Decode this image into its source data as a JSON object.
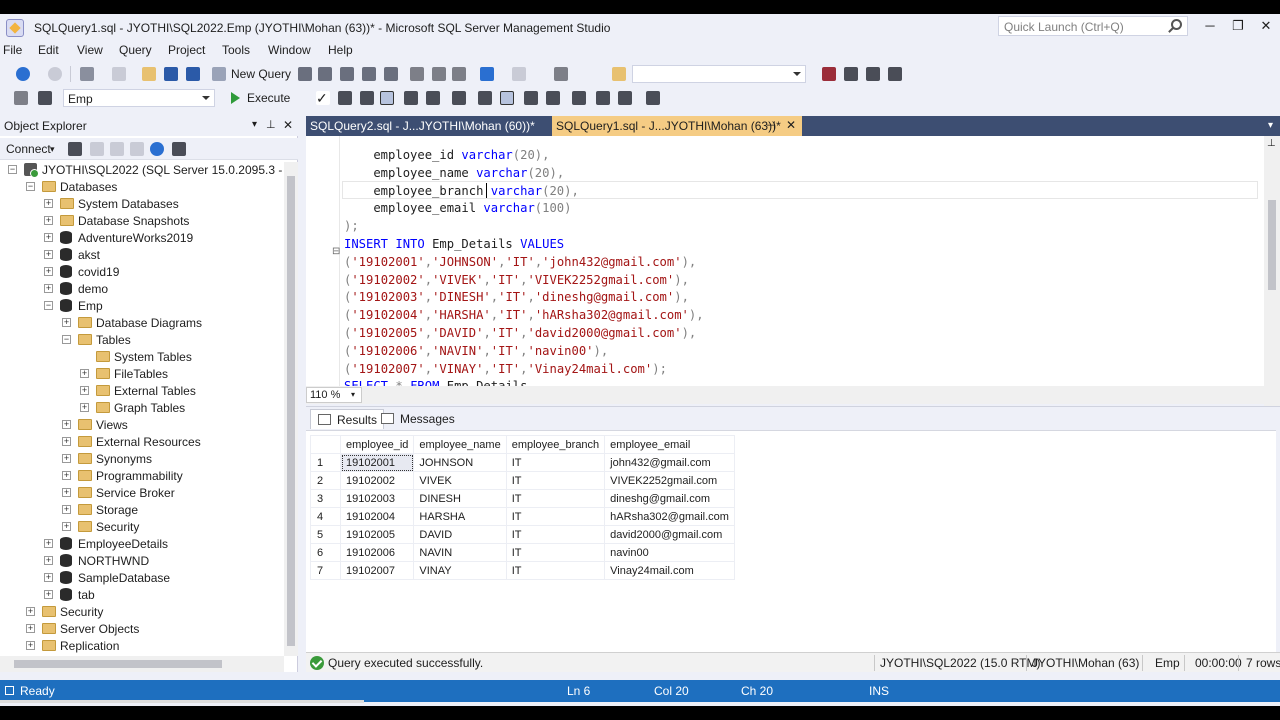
{
  "window": {
    "title": "SQLQuery1.sql - JYOTHI\\SQL2022.Emp (JYOTHI\\Mohan (63))* - Microsoft SQL Server Management Studio",
    "quick_launch_placeholder": "Quick Launch (Ctrl+Q)",
    "controls": {
      "min": "─",
      "restore": "❐",
      "close": "✕"
    }
  },
  "menu": [
    "File",
    "Edit",
    "View",
    "Query",
    "Project",
    "Tools",
    "Window",
    "Help"
  ],
  "toolbar": {
    "new_query_label": "New Query",
    "database_selected": "Emp",
    "execute_label": "Execute"
  },
  "object_explorer": {
    "title": "Object Explorer",
    "connect_label": "Connect",
    "tree": [
      {
        "label": "JYOTHI\\SQL2022 (SQL Server 15.0.2095.3 - JYOTHI\\Mohan)",
        "icon": "server-icon",
        "level": 0,
        "expander": "−"
      },
      {
        "label": "Databases",
        "icon": "folder-icon",
        "level": 1,
        "expander": "−"
      },
      {
        "label": "System Databases",
        "icon": "folder-icon",
        "level": 2,
        "expander": "+"
      },
      {
        "label": "Database Snapshots",
        "icon": "folder-icon",
        "level": 2,
        "expander": "+"
      },
      {
        "label": "AdventureWorks2019",
        "icon": "database-icon",
        "level": 2,
        "expander": "+"
      },
      {
        "label": "akst",
        "icon": "database-icon",
        "level": 2,
        "expander": "+"
      },
      {
        "label": "covid19",
        "icon": "database-icon",
        "level": 2,
        "expander": "+"
      },
      {
        "label": "demo",
        "icon": "database-icon",
        "level": 2,
        "expander": "+"
      },
      {
        "label": "Emp",
        "icon": "database-icon",
        "level": 2,
        "expander": "−"
      },
      {
        "label": "Database Diagrams",
        "icon": "folder-icon",
        "level": 3,
        "expander": "+"
      },
      {
        "label": "Tables",
        "icon": "folder-icon",
        "level": 3,
        "expander": "−"
      },
      {
        "label": "System Tables",
        "icon": "folder-icon",
        "level": 4,
        "expander": ""
      },
      {
        "label": "FileTables",
        "icon": "folder-icon",
        "level": 4,
        "expander": "+"
      },
      {
        "label": "External Tables",
        "icon": "folder-icon",
        "level": 4,
        "expander": "+"
      },
      {
        "label": "Graph Tables",
        "icon": "folder-icon",
        "level": 4,
        "expander": "+"
      },
      {
        "label": "Views",
        "icon": "folder-icon",
        "level": 3,
        "expander": "+"
      },
      {
        "label": "External Resources",
        "icon": "folder-icon",
        "level": 3,
        "expander": "+"
      },
      {
        "label": "Synonyms",
        "icon": "folder-icon",
        "level": 3,
        "expander": "+"
      },
      {
        "label": "Programmability",
        "icon": "folder-icon",
        "level": 3,
        "expander": "+"
      },
      {
        "label": "Service Broker",
        "icon": "folder-icon",
        "level": 3,
        "expander": "+"
      },
      {
        "label": "Storage",
        "icon": "folder-icon",
        "level": 3,
        "expander": "+"
      },
      {
        "label": "Security",
        "icon": "folder-icon",
        "level": 3,
        "expander": "+"
      },
      {
        "label": "EmployeeDetails",
        "icon": "database-icon",
        "level": 2,
        "expander": "+"
      },
      {
        "label": "NORTHWND",
        "icon": "database-icon",
        "level": 2,
        "expander": "+"
      },
      {
        "label": "SampleDatabase",
        "icon": "database-icon",
        "level": 2,
        "expander": "+"
      },
      {
        "label": "tab",
        "icon": "database-icon",
        "level": 2,
        "expander": "+"
      },
      {
        "label": "Security",
        "icon": "folder-icon",
        "level": 1,
        "expander": "+"
      },
      {
        "label": "Server Objects",
        "icon": "folder-icon",
        "level": 1,
        "expander": "+"
      },
      {
        "label": "Replication",
        "icon": "folder-icon",
        "level": 1,
        "expander": "+"
      }
    ]
  },
  "tabs": [
    {
      "label": "SQLQuery2.sql - J...JYOTHI\\Mohan (60))*",
      "active": false
    },
    {
      "label": "SQLQuery1.sql - J...JYOTHI\\Mohan (63))*",
      "active": true
    }
  ],
  "editor": {
    "zoom": "110 %",
    "lines": [
      [
        [
          "    employee_id ",
          "tx"
        ],
        [
          "varchar",
          "kw"
        ],
        [
          "(20)",
          "gr"
        ],
        [
          ",",
          "gr"
        ]
      ],
      [
        [
          "    employee_name ",
          "tx"
        ],
        [
          "varchar",
          "kw"
        ],
        [
          "(20)",
          "gr"
        ],
        [
          ",",
          "gr"
        ]
      ],
      [
        [
          "    employee_branch ",
          "tx"
        ],
        [
          "varchar",
          "kw"
        ],
        [
          "(20)",
          "gr"
        ],
        [
          ",",
          "gr"
        ]
      ],
      [
        [
          "    employee_email ",
          "tx"
        ],
        [
          "varchar",
          "kw"
        ],
        [
          "(100)",
          "gr"
        ]
      ],
      [
        [
          ");",
          "gr"
        ]
      ],
      [
        [
          "INSERT INTO ",
          "kw"
        ],
        [
          "Emp_Details ",
          "tx"
        ],
        [
          "VALUES",
          "kw"
        ]
      ],
      [
        [
          "(",
          "gr"
        ],
        [
          "'19102001'",
          "st"
        ],
        [
          ",",
          "gr"
        ],
        [
          "'JOHNSON'",
          "st"
        ],
        [
          ",",
          "gr"
        ],
        [
          "'IT'",
          "st"
        ],
        [
          ",",
          "gr"
        ],
        [
          "'john432@gmail.com'",
          "st"
        ],
        [
          "),",
          "gr"
        ]
      ],
      [
        [
          "(",
          "gr"
        ],
        [
          "'19102002'",
          "st"
        ],
        [
          ",",
          "gr"
        ],
        [
          "'VIVEK'",
          "st"
        ],
        [
          ",",
          "gr"
        ],
        [
          "'IT'",
          "st"
        ],
        [
          ",",
          "gr"
        ],
        [
          "'VIVEK2252gmail.com'",
          "st"
        ],
        [
          "),",
          "gr"
        ]
      ],
      [
        [
          "(",
          "gr"
        ],
        [
          "'19102003'",
          "st"
        ],
        [
          ",",
          "gr"
        ],
        [
          "'DINESH'",
          "st"
        ],
        [
          ",",
          "gr"
        ],
        [
          "'IT'",
          "st"
        ],
        [
          ",",
          "gr"
        ],
        [
          "'dineshg@gmail.com'",
          "st"
        ],
        [
          "),",
          "gr"
        ]
      ],
      [
        [
          "(",
          "gr"
        ],
        [
          "'19102004'",
          "st"
        ],
        [
          ",",
          "gr"
        ],
        [
          "'HARSHA'",
          "st"
        ],
        [
          ",",
          "gr"
        ],
        [
          "'IT'",
          "st"
        ],
        [
          ",",
          "gr"
        ],
        [
          "'hARsha302@gmail.com'",
          "st"
        ],
        [
          "),",
          "gr"
        ]
      ],
      [
        [
          "(",
          "gr"
        ],
        [
          "'19102005'",
          "st"
        ],
        [
          ",",
          "gr"
        ],
        [
          "'DAVID'",
          "st"
        ],
        [
          ",",
          "gr"
        ],
        [
          "'IT'",
          "st"
        ],
        [
          ",",
          "gr"
        ],
        [
          "'david2000@gmail.com'",
          "st"
        ],
        [
          "),",
          "gr"
        ]
      ],
      [
        [
          "(",
          "gr"
        ],
        [
          "'19102006'",
          "st"
        ],
        [
          ",",
          "gr"
        ],
        [
          "'NAVIN'",
          "st"
        ],
        [
          ",",
          "gr"
        ],
        [
          "'IT'",
          "st"
        ],
        [
          ",",
          "gr"
        ],
        [
          "'navin00'",
          "st"
        ],
        [
          "),",
          "gr"
        ]
      ],
      [
        [
          "(",
          "gr"
        ],
        [
          "'19102007'",
          "st"
        ],
        [
          ",",
          "gr"
        ],
        [
          "'VINAY'",
          "st"
        ],
        [
          ",",
          "gr"
        ],
        [
          "'IT'",
          "st"
        ],
        [
          ",",
          "gr"
        ],
        [
          "'Vinay24mail.com'",
          "st"
        ],
        [
          ");",
          "gr"
        ]
      ],
      [
        [
          "SELECT ",
          "kw"
        ],
        [
          "* ",
          "gr"
        ],
        [
          "FROM ",
          "kw"
        ],
        [
          "Emp_Details",
          "tx"
        ]
      ]
    ]
  },
  "results": {
    "tabs": [
      "Results",
      "Messages"
    ],
    "columns": [
      "employee_id",
      "employee_name",
      "employee_branch",
      "employee_email"
    ],
    "rows": [
      [
        "1",
        "19102001",
        "JOHNSON",
        "IT",
        "john432@gmail.com"
      ],
      [
        "2",
        "19102002",
        "VIVEK",
        "IT",
        "VIVEK2252gmail.com"
      ],
      [
        "3",
        "19102003",
        "DINESH",
        "IT",
        "dineshg@gmail.com"
      ],
      [
        "4",
        "19102004",
        "HARSHA",
        "IT",
        "hARsha302@gmail.com"
      ],
      [
        "5",
        "19102005",
        "DAVID",
        "IT",
        "david2000@gmail.com"
      ],
      [
        "6",
        "19102006",
        "NAVIN",
        "IT",
        "navin00"
      ],
      [
        "7",
        "19102007",
        "VINAY",
        "IT",
        "Vinay24mail.com"
      ]
    ]
  },
  "query_status": {
    "message": "Query executed successfully.",
    "server": "JYOTHI\\SQL2022 (15.0 RTM)",
    "user": "JYOTHI\\Mohan (63)",
    "database": "Emp",
    "elapsed": "00:00:00",
    "rows": "7 rows"
  },
  "status_bar": {
    "state": "Ready",
    "line": "Ln 6",
    "col": "Col 20",
    "ch": "Ch 20",
    "mode": "INS"
  },
  "colors": {
    "accent_blue": "#1e6fbf",
    "tab_active": "#f5cc84",
    "tab_strip": "#3d4e72",
    "keyword": "#0000ff",
    "string": "#a31515"
  }
}
